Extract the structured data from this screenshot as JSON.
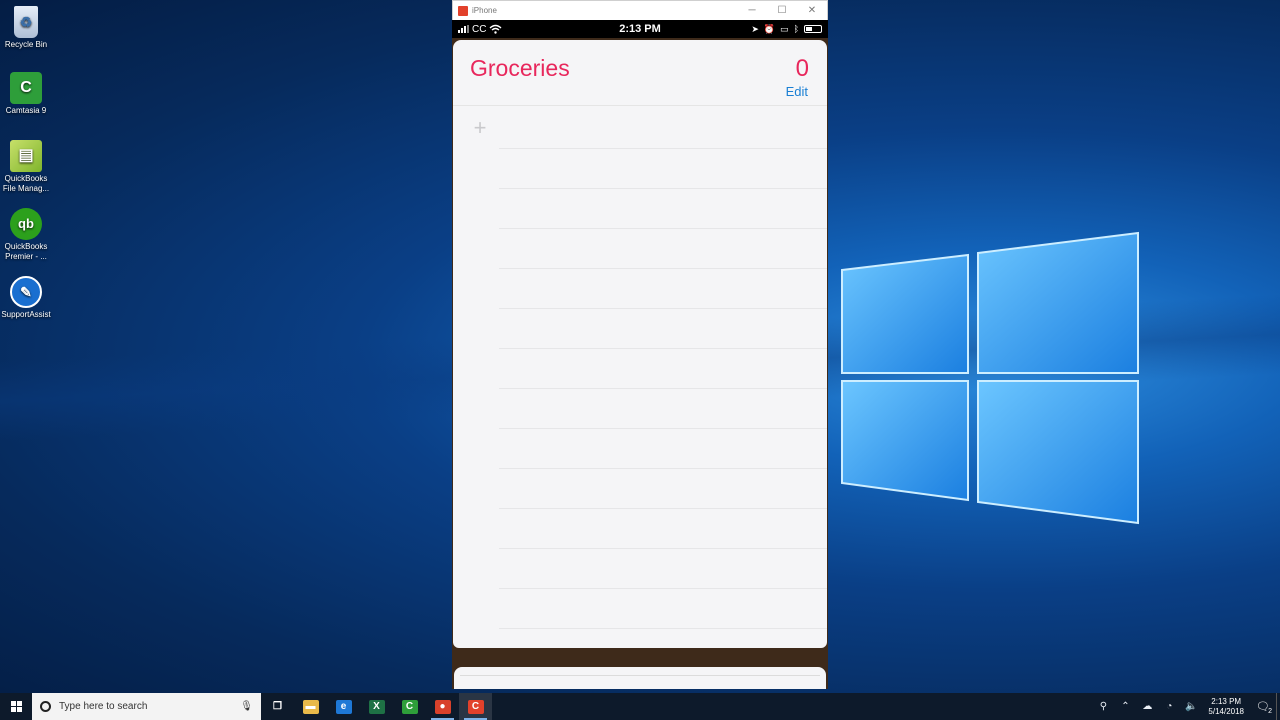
{
  "desktop": {
    "icons": [
      {
        "label": "Recycle Bin",
        "icon": "recycle-bin-icon",
        "glyph": "♻"
      },
      {
        "label": "Camtasia 9",
        "icon": "camtasia-icon",
        "glyph": "C"
      },
      {
        "label": "QuickBooks File Manag...",
        "icon": "quickbooks-file-manager-icon",
        "glyph": "▤"
      },
      {
        "label": "QuickBooks Premier - ...",
        "icon": "quickbooks-premier-icon",
        "glyph": "qb"
      },
      {
        "label": "SupportAssist",
        "icon": "supportassist-icon",
        "glyph": "✎"
      }
    ]
  },
  "window": {
    "title": "iPhone",
    "controls": {
      "minimize": "─",
      "maximize": "☐",
      "close": "✕"
    }
  },
  "ios_status": {
    "carrier": "CC",
    "time": "2:13 PM",
    "battery_level": 0.45
  },
  "reminders": {
    "list_title": "Groceries",
    "count": "0",
    "edit_label": "Edit",
    "add_glyph": "+"
  },
  "taskbar": {
    "search_placeholder": "Type here to search",
    "apps": [
      {
        "name": "task-view",
        "glyph": "❐",
        "color": "transparent"
      },
      {
        "name": "file-explorer",
        "glyph": "▬",
        "color": "#e8b94a"
      },
      {
        "name": "edge",
        "glyph": "e",
        "color": "#1e78d6"
      },
      {
        "name": "excel",
        "glyph": "X",
        "color": "#1e7145"
      },
      {
        "name": "camtasia",
        "glyph": "C",
        "color": "#2e9e3a"
      },
      {
        "name": "recorder",
        "glyph": "●",
        "color": "#d8412b"
      },
      {
        "name": "camtasia-recorder",
        "glyph": "C",
        "color": "#e2412b"
      }
    ],
    "clock_time": "2:13 PM",
    "clock_date": "5/14/2018",
    "notification_count": "2"
  }
}
